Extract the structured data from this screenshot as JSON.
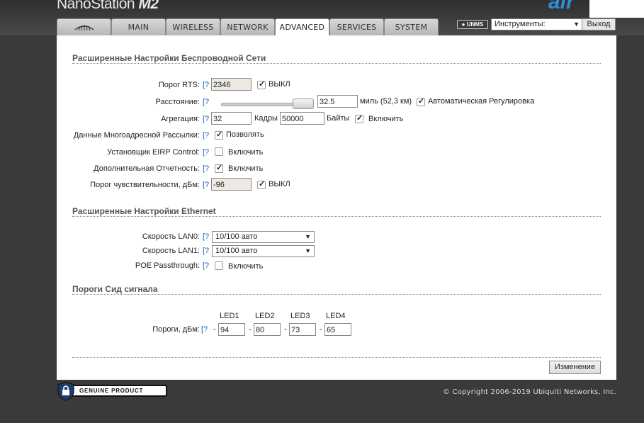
{
  "header": {
    "product_name": "NanoStation",
    "product_model": "M2",
    "brand_fragment": "air",
    "tabs": [
      "",
      "MAIN",
      "WIRELESS",
      "NETWORK",
      "ADVANCED",
      "SERVICES",
      "SYSTEM"
    ],
    "active_tab": "ADVANCED",
    "unms_badge": "UNMS",
    "tools_select": "Инструменты:",
    "logout_label": "Выход"
  },
  "wireless": {
    "title": "Расширенные Настройки Беспроводной Сети",
    "help_marker": "[?",
    "rts_label": "Порог RTS:",
    "rts_value": "2346",
    "rts_off_label": "ВЫКЛ",
    "rts_off_checked": true,
    "distance_label": "Расстояние:",
    "distance_value": "32.5",
    "distance_unit": "миль (52,3 км)",
    "auto_adjust_label": "Автоматическая Регулировка",
    "auto_adjust_checked": true,
    "aggregation_label": "Агрегация:",
    "aggregation_frames": "32",
    "frames_label": "Кадры",
    "aggregation_bytes": "50000",
    "bytes_label": "Байты",
    "aggregation_enable_label": "Включить",
    "aggregation_enabled": true,
    "multicast_label": "Данные Многоадресной Рассылки:",
    "multicast_allow_label": "Позволять",
    "multicast_allowed": true,
    "eirp_label": "Установщик EIRP Control:",
    "eirp_enable_label": "Включить",
    "eirp_enabled": false,
    "extra_report_label": "Дополнительная Отчетность:",
    "extra_report_enable_label": "Включить",
    "extra_report_enabled": true,
    "sensitivity_label": "Порог чувствительности, дБм:",
    "sensitivity_value": "-96",
    "sensitivity_off_label": "ВЫКЛ",
    "sensitivity_off_checked": true
  },
  "ethernet": {
    "title": "Расширенные Настройки Ethernet",
    "lan0_label": "Скорость LAN0:",
    "lan0_value": "10/100 авто",
    "lan1_label": "Скорость LAN1:",
    "lan1_value": "10/100 авто",
    "poe_label": "POE Passthrough:",
    "poe_enable_label": "Включить",
    "poe_enabled": false
  },
  "signal_leds": {
    "title": "Пороги Сид сигнала",
    "led_headers": [
      "LED1",
      "LED2",
      "LED3",
      "LED4"
    ],
    "thresholds_label": "Пороги, дБм:",
    "thresholds": [
      "94",
      "80",
      "73",
      "65"
    ],
    "dash": "-"
  },
  "actions": {
    "change_label": "Изменение"
  },
  "footer": {
    "badge_text": "GENUINE PRODUCT",
    "copyright": "© Copyright 2006-2019 Ubiquiti Networks, Inc."
  }
}
